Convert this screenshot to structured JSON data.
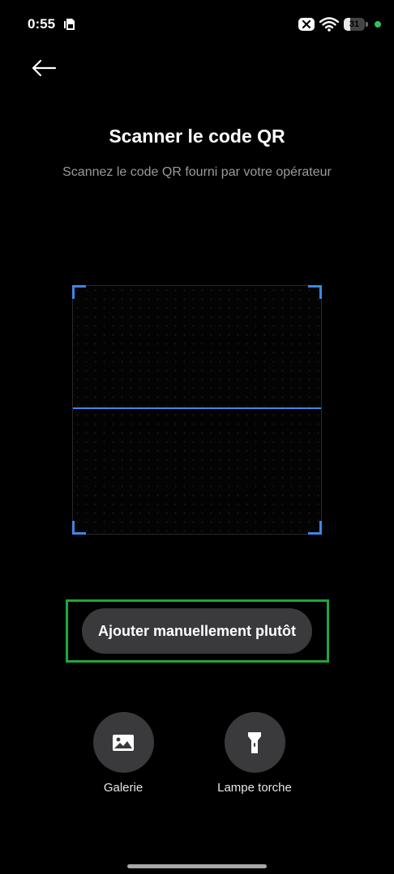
{
  "status_bar": {
    "time": "0:55",
    "battery_level": "31",
    "battery_percent": 31,
    "icons": [
      "sim-card-icon",
      "no-data-icon",
      "wifi-icon",
      "battery-icon",
      "privacy-dot"
    ]
  },
  "header": {
    "back_icon": "arrow-left-icon"
  },
  "scan": {
    "title": "Scanner le code QR",
    "subtitle": "Scannez le code QR fourni par votre opérateur"
  },
  "manual_add": {
    "label": "Ajouter manuellement plutôt"
  },
  "actions": [
    {
      "label": "Galerie",
      "icon": "image-icon"
    },
    {
      "label": "Lampe torche",
      "icon": "flashlight-icon"
    }
  ],
  "colors": {
    "background": "#000000",
    "accent_blue": "#3e86e6",
    "highlight_green": "#1fa63a",
    "button_bg": "#3a3a3c",
    "subtitle": "#9a9a9a"
  }
}
